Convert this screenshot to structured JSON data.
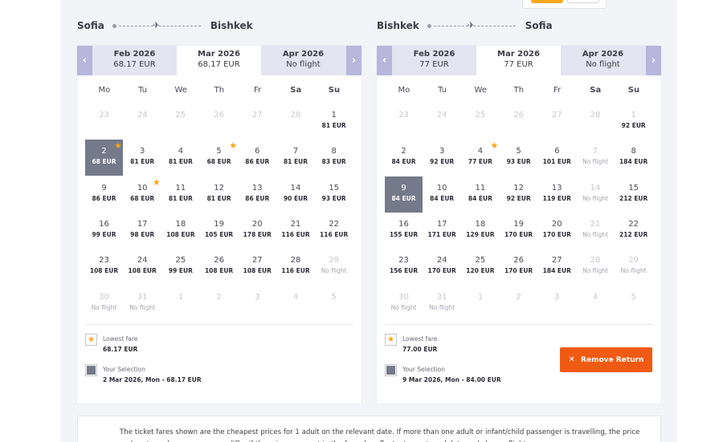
{
  "outbound": {
    "route_from": "Sofia",
    "route_to": "Bishkek",
    "months": [
      {
        "name": "Feb 2026",
        "price": "68.17 EUR"
      },
      {
        "name": "Mar 2026",
        "price": "68.17 EUR"
      },
      {
        "name": "Apr 2026",
        "price": "No flight"
      }
    ],
    "weekdays": [
      "Mo",
      "Tu",
      "We",
      "Th",
      "Fr",
      "Sa",
      "Su"
    ],
    "days": [
      {
        "d": "23",
        "p": "",
        "out": true
      },
      {
        "d": "24",
        "p": "",
        "out": true
      },
      {
        "d": "25",
        "p": "",
        "out": true
      },
      {
        "d": "26",
        "p": "",
        "out": true
      },
      {
        "d": "27",
        "p": "",
        "out": true
      },
      {
        "d": "28",
        "p": "",
        "out": true
      },
      {
        "d": "1",
        "p": "81 EUR"
      },
      {
        "d": "2",
        "p": "68 EUR",
        "sel": true,
        "star": true
      },
      {
        "d": "3",
        "p": "81 EUR"
      },
      {
        "d": "4",
        "p": "81 EUR"
      },
      {
        "d": "5",
        "p": "68 EUR",
        "star": true
      },
      {
        "d": "6",
        "p": "86 EUR"
      },
      {
        "d": "7",
        "p": "81 EUR"
      },
      {
        "d": "8",
        "p": "83 EUR"
      },
      {
        "d": "9",
        "p": "86 EUR"
      },
      {
        "d": "10",
        "p": "68 EUR",
        "star": true
      },
      {
        "d": "11",
        "p": "81 EUR"
      },
      {
        "d": "12",
        "p": "81 EUR"
      },
      {
        "d": "13",
        "p": "86 EUR"
      },
      {
        "d": "14",
        "p": "90 EUR"
      },
      {
        "d": "15",
        "p": "93 EUR"
      },
      {
        "d": "16",
        "p": "99 EUR"
      },
      {
        "d": "17",
        "p": "98 EUR"
      },
      {
        "d": "18",
        "p": "108 EUR"
      },
      {
        "d": "19",
        "p": "105 EUR"
      },
      {
        "d": "20",
        "p": "178 EUR"
      },
      {
        "d": "21",
        "p": "116 EUR"
      },
      {
        "d": "22",
        "p": "116 EUR"
      },
      {
        "d": "23",
        "p": "108 EUR"
      },
      {
        "d": "24",
        "p": "108 EUR"
      },
      {
        "d": "25",
        "p": "99 EUR"
      },
      {
        "d": "26",
        "p": "108 EUR"
      },
      {
        "d": "27",
        "p": "108 EUR"
      },
      {
        "d": "28",
        "p": "116 EUR"
      },
      {
        "d": "29",
        "p": "No flight",
        "nf": true
      },
      {
        "d": "30",
        "p": "No flight",
        "nf": true
      },
      {
        "d": "31",
        "p": "No flight",
        "nf": true
      },
      {
        "d": "1",
        "p": "",
        "out": true
      },
      {
        "d": "2",
        "p": "",
        "out": true
      },
      {
        "d": "3",
        "p": "",
        "out": true
      },
      {
        "d": "4",
        "p": "",
        "out": true
      },
      {
        "d": "5",
        "p": "",
        "out": true
      }
    ],
    "legend": {
      "lowest_label": "Lowest fare",
      "lowest_value": "68.17 EUR",
      "selection_label": "Your Selection",
      "selection_value": "2 Mar 2026, Mon - 68.17 EUR"
    }
  },
  "return": {
    "route_from": "Bishkek",
    "route_to": "Sofia",
    "months": [
      {
        "name": "Feb 2026",
        "price": "77 EUR"
      },
      {
        "name": "Mar 2026",
        "price": "77 EUR"
      },
      {
        "name": "Apr 2026",
        "price": "No flight"
      }
    ],
    "weekdays": [
      "Mo",
      "Tu",
      "We",
      "Th",
      "Fr",
      "Sa",
      "Su"
    ],
    "days": [
      {
        "d": "23",
        "p": "",
        "out": true
      },
      {
        "d": "24",
        "p": "",
        "out": true
      },
      {
        "d": "25",
        "p": "",
        "out": true
      },
      {
        "d": "26",
        "p": "",
        "out": true
      },
      {
        "d": "27",
        "p": "",
        "out": true
      },
      {
        "d": "28",
        "p": "",
        "out": true
      },
      {
        "d": "1",
        "p": "92 EUR",
        "outday": true
      },
      {
        "d": "2",
        "p": "84 EUR"
      },
      {
        "d": "3",
        "p": "92 EUR"
      },
      {
        "d": "4",
        "p": "77 EUR",
        "star": true
      },
      {
        "d": "5",
        "p": "93 EUR"
      },
      {
        "d": "6",
        "p": "101 EUR"
      },
      {
        "d": "7",
        "p": "No flight",
        "nf": true
      },
      {
        "d": "8",
        "p": "184 EUR"
      },
      {
        "d": "9",
        "p": "84 EUR",
        "sel": true
      },
      {
        "d": "10",
        "p": "84 EUR"
      },
      {
        "d": "11",
        "p": "84 EUR"
      },
      {
        "d": "12",
        "p": "92 EUR"
      },
      {
        "d": "13",
        "p": "119 EUR"
      },
      {
        "d": "14",
        "p": "No flight",
        "nf": true
      },
      {
        "d": "15",
        "p": "212 EUR"
      },
      {
        "d": "16",
        "p": "155 EUR"
      },
      {
        "d": "17",
        "p": "171 EUR"
      },
      {
        "d": "18",
        "p": "129 EUR"
      },
      {
        "d": "19",
        "p": "170 EUR"
      },
      {
        "d": "20",
        "p": "170 EUR"
      },
      {
        "d": "21",
        "p": "No flight",
        "nf": true
      },
      {
        "d": "22",
        "p": "212 EUR"
      },
      {
        "d": "23",
        "p": "156 EUR"
      },
      {
        "d": "24",
        "p": "170 EUR"
      },
      {
        "d": "25",
        "p": "120 EUR"
      },
      {
        "d": "26",
        "p": "170 EUR"
      },
      {
        "d": "27",
        "p": "184 EUR"
      },
      {
        "d": "28",
        "p": "No flight",
        "nf": true
      },
      {
        "d": "29",
        "p": "No flight",
        "nf": true
      },
      {
        "d": "30",
        "p": "No flight",
        "nf": true
      },
      {
        "d": "31",
        "p": "No flight",
        "nf": true
      },
      {
        "d": "1",
        "p": "",
        "out": true
      },
      {
        "d": "2",
        "p": "",
        "out": true
      },
      {
        "d": "3",
        "p": "",
        "out": true
      },
      {
        "d": "4",
        "p": "",
        "out": true
      },
      {
        "d": "5",
        "p": "",
        "out": true
      }
    ],
    "legend": {
      "lowest_label": "Lowest fare",
      "lowest_value": "77.00 EUR",
      "selection_label": "Your Selection",
      "selection_value": "9 Mar 2026, Mon - 84.00 EUR"
    },
    "remove_label": "Remove Return"
  },
  "note_text": "The ticket fares shown are the cheapest prices for 1 adult on the relevant date. If more than one adult or infant/child passenger is travelling, the price and seat numbers may vary or differ if the prices per seat in the fare class fluctuate per travel date and chosen flight.",
  "colors": {
    "accent": "#b9b6dc",
    "selected": "#747a8a",
    "star": "#f5a516",
    "remove": "#f05a12"
  }
}
